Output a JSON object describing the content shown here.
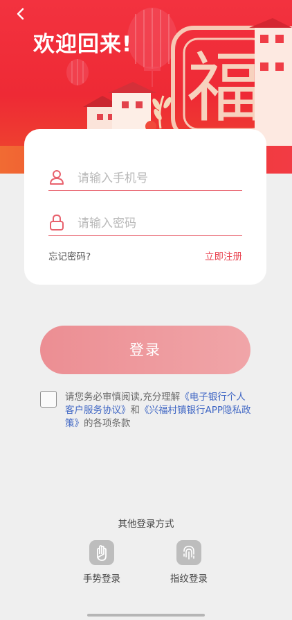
{
  "header": {
    "title": "欢迎回来!",
    "fu_character": "福"
  },
  "form": {
    "phone_placeholder": "请输入手机号",
    "password_placeholder": "请输入密码",
    "forgot_label": "忘记密码?",
    "register_label": "立即注册"
  },
  "login_button_label": "登录",
  "agreement": {
    "prefix": "请您务必审慎阅读,充分理解",
    "link1": "《电子银行个人客户服务协议》",
    "middle": "和",
    "link2": "《兴福村镇银行APP隐私政策》",
    "suffix": "的各项条款"
  },
  "other_login": {
    "title": "其他登录方式",
    "gesture_label": "手势登录",
    "fingerprint_label": "指纹登录"
  },
  "colors": {
    "brand_red": "#ee2a35",
    "accent_pink": "#e8616d",
    "link_blue": "#3f66c4",
    "button_pink": "#ec8e93"
  },
  "icons": [
    "back-icon",
    "user-icon",
    "lock-icon",
    "gesture-hand-icon",
    "fingerprint-icon"
  ]
}
